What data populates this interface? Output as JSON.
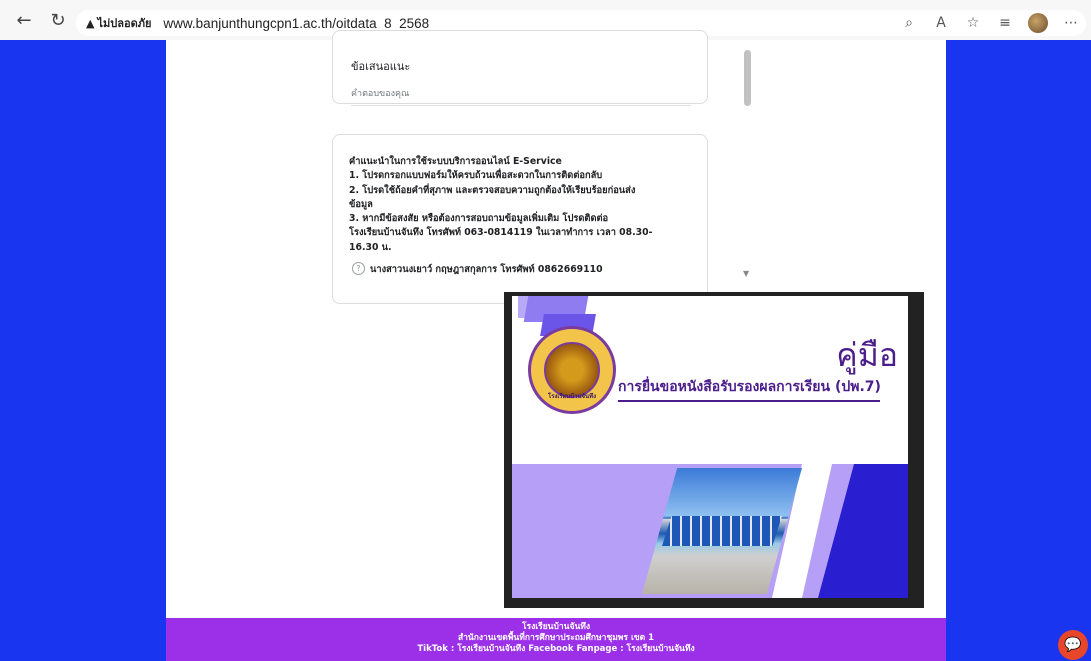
{
  "browser": {
    "warning_label": "ไม่ปลอดภัย",
    "url": "www.banjunthungcpn1.ac.th/oitdata_8_2568"
  },
  "form": {
    "question_title": "ข้อเสนอแนะ",
    "answer_placeholder": "คำตอบของคุณ",
    "instructions": [
      "คำแนะนำในการใช้ระบบบริการออนไลน์ E-Service",
      "1. โปรดกรอกแบบฟอร์มให้ครบถ้วนเพื่อสะดวกในการติดต่อกลับ",
      "2. โปรดใช้ถ้อยคำที่สุภาพ และตรวจสอบความถูกต้องให้เรียบร้อยก่อนส่ง",
      "ข้อมูล",
      "3. หากมีข้อสงสัย หรือต้องการสอบถามข้อมูลเพิ่มเติม โปรดติดต่อ",
      "โรงเรียนบ้านจันทึง โทรศัพท์ 063-0814119 ในเวลาทำการ เวลา 08.30-",
      "16.30 น."
    ],
    "contact_line": "นางสาวนงเยาว์ กฤษฎาสกุลการ โทรศัพท์ 0862669110"
  },
  "manual": {
    "title": "คู่มือ",
    "subtitle": "การยื่นขอหนังสือรับรองผลการเรียน (ปพ.7)",
    "seal_text": "โรงเรียนบ้านจันทึง"
  },
  "footer": {
    "line1": "โรงเรียนบ้านจันทึง",
    "line2": "สำนักงานเขตพื้นที่การศึกษาประถมศึกษาชุมพร เขต 1",
    "line3": "TikTok : โรงเรียนบ้านจันทึง  Facebook Fanpage : โรงเรียนบ้านจันทึง"
  },
  "colors": {
    "page_bg": "#1a35f0",
    "footer_bg": "#9b30e8",
    "manual_purple": "#4b1e8c"
  }
}
